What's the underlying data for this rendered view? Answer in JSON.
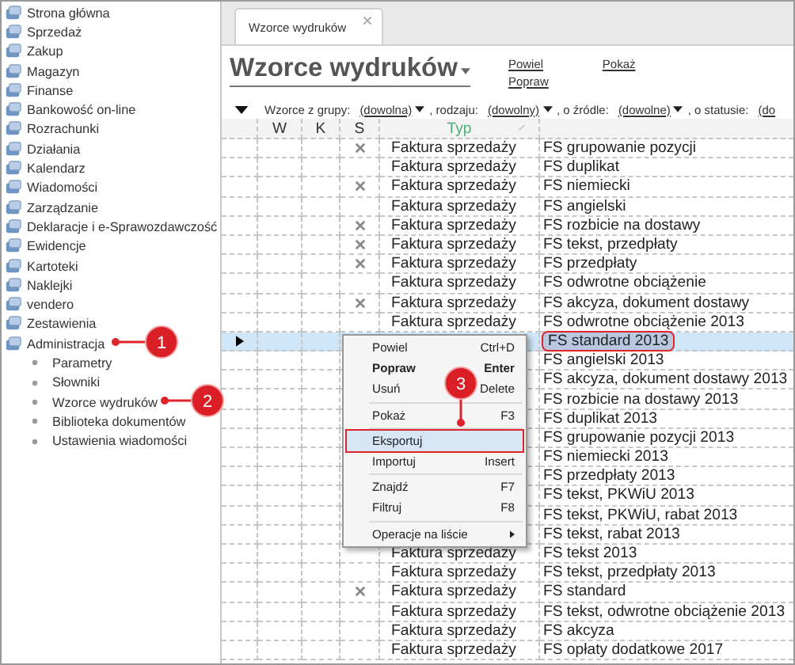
{
  "sidebar": {
    "items": [
      {
        "label": "Strona główna"
      },
      {
        "label": "Sprzedaż"
      },
      {
        "label": "Zakup"
      },
      {
        "label": "Magazyn"
      },
      {
        "label": "Finanse"
      },
      {
        "label": "Bankowość on-line"
      },
      {
        "label": "Rozrachunki"
      },
      {
        "label": "Działania"
      },
      {
        "label": "Kalendarz"
      },
      {
        "label": "Wiadomości"
      },
      {
        "label": "Zarządzanie"
      },
      {
        "label": "Deklaracje i e-Sprawozdawczość"
      },
      {
        "label": "Ewidencje"
      },
      {
        "label": "Kartoteki"
      },
      {
        "label": "Naklejki"
      },
      {
        "label": "vendero"
      },
      {
        "label": "Zestawienia"
      },
      {
        "label": "Administracja",
        "children": [
          {
            "label": "Parametry"
          },
          {
            "label": "Słowniki"
          },
          {
            "label": "Wzorce wydruków"
          },
          {
            "label": "Biblioteka dokumentów"
          },
          {
            "label": "Ustawienia wiadomości"
          }
        ]
      }
    ]
  },
  "tabs": [
    {
      "label": "Wzorce wydruków",
      "selected": true
    }
  ],
  "header": {
    "title": "Wzorce wydruków",
    "actions": [
      "Powiel",
      "Popraw",
      "Pokaż"
    ]
  },
  "filters": [
    {
      "label": "Wzorce z grupy:",
      "value": "(dowolna)",
      "caret": true
    },
    {
      "label": ", rodzaju:",
      "value": "(dowolny)",
      "caret": true
    },
    {
      "label": ", o źródle:",
      "value": "(dowolne)",
      "caret": true
    },
    {
      "label": ", o statusie:",
      "value": "(do",
      "caret": false
    }
  ],
  "table": {
    "columns": [
      {
        "label": "W",
        "sorted": false
      },
      {
        "label": "K",
        "sorted": false
      },
      {
        "label": "S",
        "sorted": false
      },
      {
        "label": "Typ",
        "sorted": true
      }
    ],
    "rows": [
      {
        "s": true,
        "typ": "Faktura sprzedaży",
        "name": "FS grupowanie pozycji",
        "selected": false,
        "highlighted": false
      },
      {
        "s": false,
        "typ": "Faktura sprzedaży",
        "name": "FS duplikat",
        "selected": false,
        "highlighted": false
      },
      {
        "s": true,
        "typ": "Faktura sprzedaży",
        "name": "FS niemiecki",
        "selected": false,
        "highlighted": false
      },
      {
        "s": false,
        "typ": "Faktura sprzedaży",
        "name": "FS angielski",
        "selected": false,
        "highlighted": false
      },
      {
        "s": true,
        "typ": "Faktura sprzedaży",
        "name": "FS rozbicie na dostawy",
        "selected": false,
        "highlighted": false
      },
      {
        "s": true,
        "typ": "Faktura sprzedaży",
        "name": "FS tekst, przedpłaty",
        "selected": false,
        "highlighted": false
      },
      {
        "s": true,
        "typ": "Faktura sprzedaży",
        "name": "FS przedpłaty",
        "selected": false,
        "highlighted": false
      },
      {
        "s": false,
        "typ": "Faktura sprzedaży",
        "name": "FS odwrotne obciążenie",
        "selected": false,
        "highlighted": false
      },
      {
        "s": true,
        "typ": "Faktura sprzedaży",
        "name": "FS akcyza, dokument dostawy",
        "selected": false,
        "highlighted": false
      },
      {
        "s": false,
        "typ": "Faktura sprzedaży",
        "name": "FS odwrotne obciążenie 2013",
        "selected": false,
        "highlighted": false
      },
      {
        "s": false,
        "name": "FS standard 2013",
        "selected": true,
        "highlighted": true
      },
      {
        "s": false,
        "name": "FS angielski 2013",
        "selected": false,
        "highlighted": false
      },
      {
        "s": false,
        "name": "FS akcyza, dokument dostawy 2013",
        "selected": false,
        "highlighted": false
      },
      {
        "s": false,
        "name": "FS rozbicie na dostawy 2013",
        "selected": false,
        "highlighted": false
      },
      {
        "s": false,
        "name": "FS duplikat 2013",
        "selected": false,
        "highlighted": false
      },
      {
        "s": false,
        "name": "FS grupowanie pozycji 2013",
        "selected": false,
        "highlighted": false
      },
      {
        "s": false,
        "name": "FS niemiecki 2013",
        "selected": false,
        "highlighted": false
      },
      {
        "s": false,
        "name": "FS przedpłaty 2013",
        "selected": false,
        "highlighted": false
      },
      {
        "s": false,
        "name": "FS tekst, PKWiU 2013",
        "selected": false,
        "highlighted": false
      },
      {
        "s": false,
        "name": "FS tekst, PKWiU, rabat 2013",
        "selected": false,
        "highlighted": false
      },
      {
        "s": false,
        "name": "FS tekst, rabat 2013",
        "selected": false,
        "highlighted": false
      },
      {
        "s": false,
        "typ": "Faktura sprzedaży",
        "name": "FS tekst 2013",
        "selected": false,
        "highlighted": false
      },
      {
        "s": false,
        "typ": "Faktura sprzedaży",
        "name": "FS tekst, przedpłaty 2013",
        "selected": false,
        "highlighted": false
      },
      {
        "s": true,
        "typ": "Faktura sprzedaży",
        "name": "FS standard",
        "selected": false,
        "highlighted": false
      },
      {
        "s": false,
        "typ": "Faktura sprzedaży",
        "name": "FS tekst, odwrotne obciążenie 2013",
        "selected": false,
        "highlighted": false
      },
      {
        "s": false,
        "typ": "Faktura sprzedaży",
        "name": "FS akcyza",
        "selected": false,
        "highlighted": false
      },
      {
        "s": false,
        "typ": "Faktura sprzedaży",
        "name": "FS opłaty dodatkowe 2017",
        "selected": false,
        "highlighted": false
      }
    ]
  },
  "context_menu": {
    "items": [
      {
        "kind": "item",
        "label": "Powiel",
        "shortcut": "Ctrl+D",
        "bold": false,
        "selected": false
      },
      {
        "kind": "item",
        "label": "Popraw",
        "shortcut": "Enter",
        "bold": true,
        "selected": false
      },
      {
        "kind": "item",
        "label": "Usuń",
        "shortcut": "Delete",
        "bold": false,
        "selected": false
      },
      {
        "kind": "separator"
      },
      {
        "kind": "item",
        "label": "Pokaż",
        "shortcut": "F3",
        "bold": false,
        "selected": false
      },
      {
        "kind": "separator"
      },
      {
        "kind": "item",
        "label": "Eksportuj",
        "bold": false,
        "selected": true
      },
      {
        "kind": "item",
        "label": "Importuj",
        "shortcut": "Insert",
        "bold": false,
        "selected": false
      },
      {
        "kind": "separator"
      },
      {
        "kind": "item",
        "label": "Znajdź",
        "shortcut": "F7",
        "bold": false,
        "selected": false
      },
      {
        "kind": "item",
        "label": "Filtruj",
        "shortcut": "F8",
        "bold": false,
        "selected": false
      },
      {
        "kind": "separator"
      },
      {
        "kind": "submenu",
        "label": "Operacje na liście"
      }
    ]
  },
  "annotations": [
    "1",
    "2",
    "3"
  ]
}
